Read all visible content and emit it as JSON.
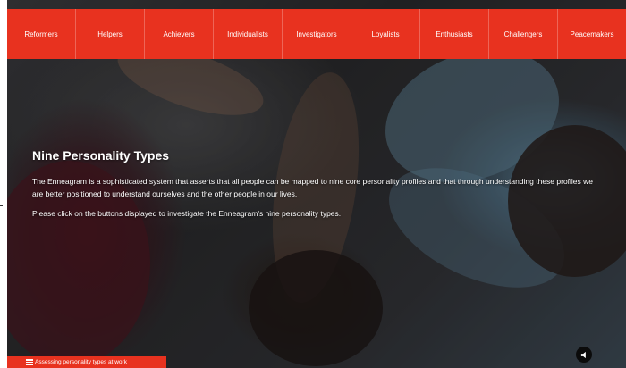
{
  "nav": {
    "items": [
      {
        "label": "Reformers"
      },
      {
        "label": "Helpers"
      },
      {
        "label": "Achievers"
      },
      {
        "label": "Individualists"
      },
      {
        "label": "Investigators"
      },
      {
        "label": "Loyalists"
      },
      {
        "label": "Enthusiasts"
      },
      {
        "label": "Challengers"
      },
      {
        "label": "Peacemakers"
      }
    ]
  },
  "main": {
    "title": "Nine Personality Types",
    "paragraph1": "The Enneagram is a sophisticated system that asserts that all people can be mapped to nine core personality profiles and that through understanding these profiles we are better positioned to understand ourselves and the other people in our lives.",
    "paragraph2": "Please click on the buttons displayed to investigate the Enneagram's nine personality types."
  },
  "footer": {
    "menu_label": "Assessing personality types at work"
  },
  "icons": {
    "menu": "hamburger-menu-icon",
    "sound": "speaker-icon"
  },
  "colors": {
    "accent": "#e8321f",
    "nav_text": "#ffffff"
  }
}
